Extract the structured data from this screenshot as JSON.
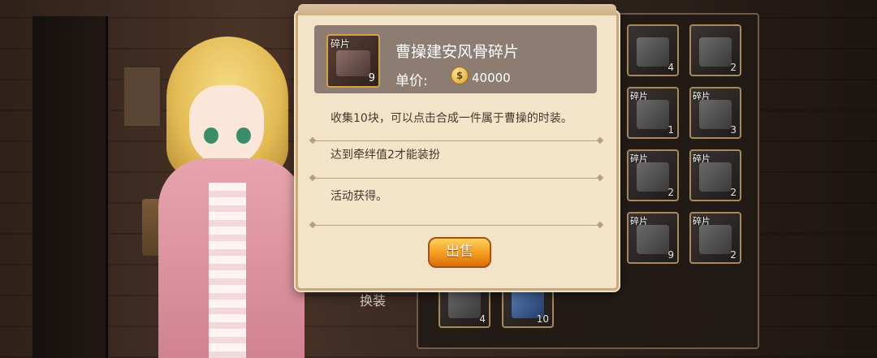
{
  "dialog": {
    "item": {
      "tag": "碎片",
      "count": "9",
      "name": "曹操建安风骨碎片",
      "price_label": "单价:",
      "price": "40000",
      "coin_icon": "coin-icon"
    },
    "descriptions": [
      "收集10块，可以点击合成一件属于曹操的时装。",
      "达到牵绊值2才能装扮",
      "活动获得。"
    ],
    "sell_button": "出售"
  },
  "background": {
    "equip_label": "换装",
    "fragment_slots": [
      {
        "tag": "",
        "count": "4"
      },
      {
        "tag": "",
        "count": "2"
      },
      {
        "tag": "碎片",
        "count": "1"
      },
      {
        "tag": "碎片",
        "count": "3"
      },
      {
        "tag": "碎片",
        "count": "2"
      },
      {
        "tag": "碎片",
        "count": "2"
      },
      {
        "tag": "碎片",
        "count": "9"
      },
      {
        "tag": "碎片",
        "count": "2"
      },
      {
        "tag": "",
        "count": "4"
      },
      {
        "tag": "",
        "count": "10"
      }
    ]
  }
}
